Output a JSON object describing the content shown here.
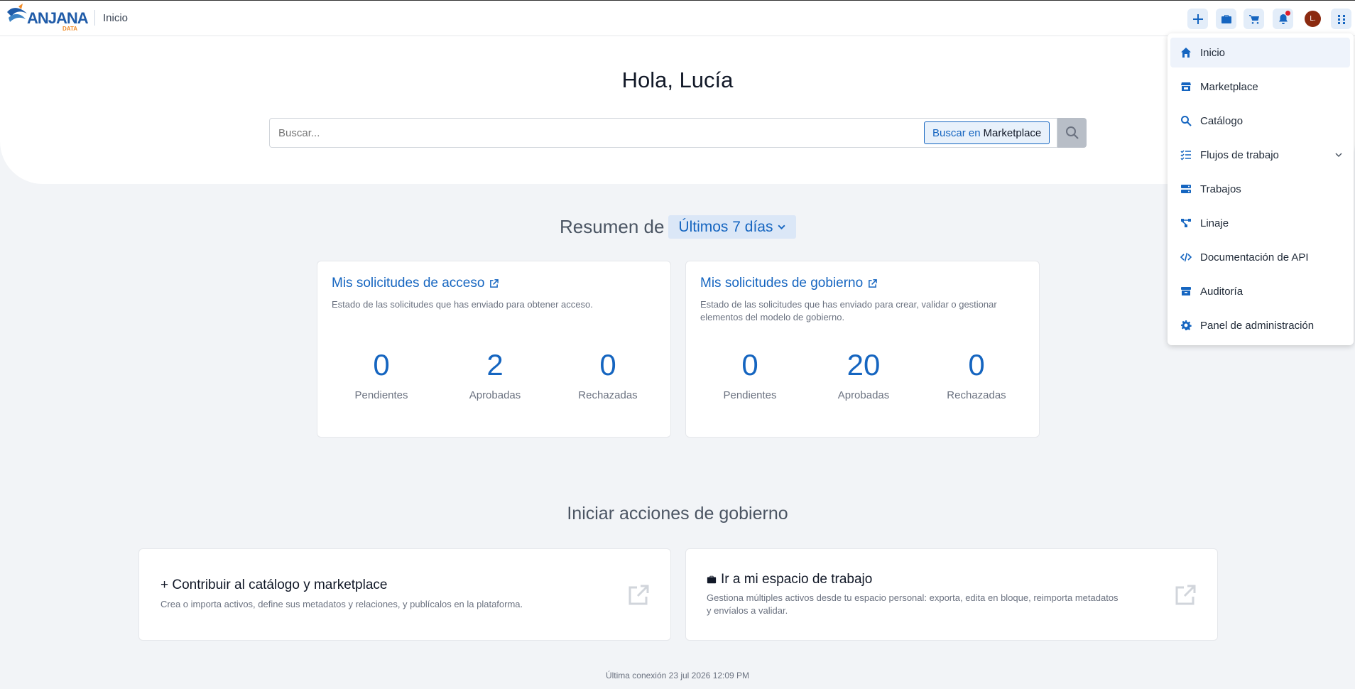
{
  "header": {
    "logo_text": "ANJANA",
    "logo_sub": "DATA",
    "breadcrumb": "Inicio",
    "avatar_initial": "L.",
    "buttons": [
      "add",
      "briefcase",
      "cart",
      "notifications",
      "apps"
    ]
  },
  "hero": {
    "greeting": "Hola, Lucía",
    "search_placeholder": "Buscar...",
    "search_chip_prefix": "Buscar en",
    "search_chip_target": "Marketplace"
  },
  "summary": {
    "label": "Resumen de",
    "range": "Últimos 7 días"
  },
  "cards": [
    {
      "title": "Mis solicitudes de acceso",
      "description": "Estado de las solicitudes que has enviado para obtener acceso.",
      "stats": [
        {
          "value": "0",
          "label": "Pendientes"
        },
        {
          "value": "2",
          "label": "Aprobadas"
        },
        {
          "value": "0",
          "label": "Rechazadas"
        }
      ]
    },
    {
      "title": "Mis solicitudes de gobierno",
      "description": "Estado de las solicitudes que has enviado para crear, validar o gestionar elementos del modelo de gobierno.",
      "stats": [
        {
          "value": "0",
          "label": "Pendientes"
        },
        {
          "value": "20",
          "label": "Aprobadas"
        },
        {
          "value": "0",
          "label": "Rechazadas"
        }
      ]
    }
  ],
  "actions": {
    "title": "Iniciar acciones de gobierno",
    "items": [
      {
        "title": "+ Contribuir al catálogo y marketplace",
        "description": "Crea o importa activos, define sus metadatos y relaciones, y publícalos en la plataforma."
      },
      {
        "title": "Ir a mi espacio de trabajo",
        "description": "Gestiona múltiples activos desde tu espacio personal: exporta, edita en bloque, reimporta metadatos y envíalos a validar."
      }
    ]
  },
  "footer": {
    "last_login": "Última conexión 23 jul 2026 12:09 PM"
  },
  "menu": {
    "items": [
      {
        "label": "Inicio",
        "icon": "home-icon",
        "active": true
      },
      {
        "label": "Marketplace",
        "icon": "store-icon"
      },
      {
        "label": "Catálogo",
        "icon": "search-icon"
      },
      {
        "label": "Flujos de trabajo",
        "icon": "list-check-icon",
        "expandable": true
      },
      {
        "label": "Trabajos",
        "icon": "server-icon"
      },
      {
        "label": "Linaje",
        "icon": "lineage-icon"
      },
      {
        "label": "Documentación de API",
        "icon": "code-icon"
      },
      {
        "label": "Auditoría",
        "icon": "archive-icon"
      },
      {
        "label": "Panel de administración",
        "icon": "gear-icon"
      }
    ]
  },
  "colors": {
    "primary": "#1565c0",
    "background": "#f2f4f7",
    "notification": "#e11d2a",
    "avatar": "#8b2a10"
  }
}
